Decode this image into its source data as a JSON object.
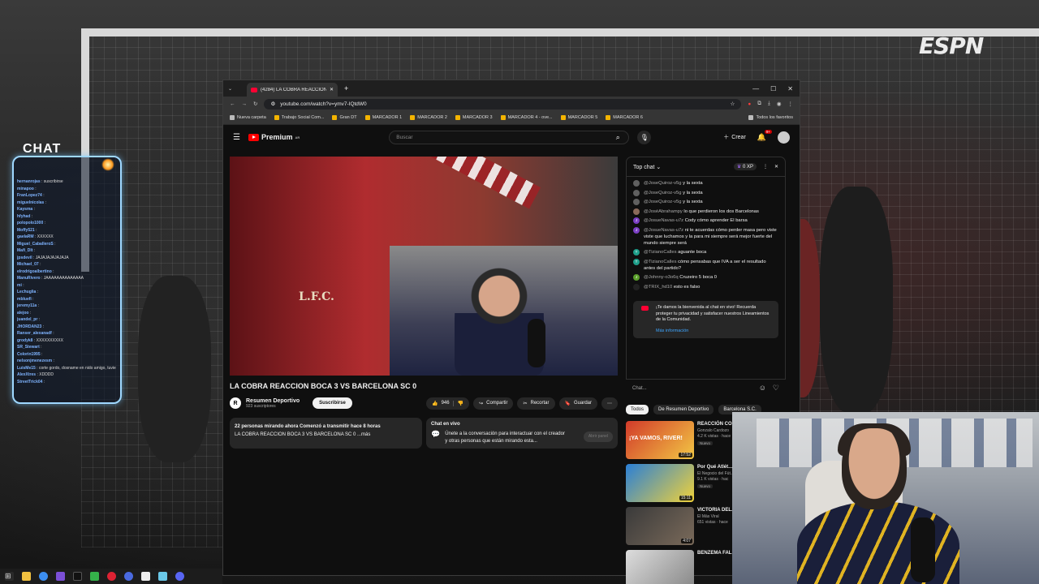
{
  "overlay": {
    "chat_title": "CHAT",
    "brand": "ESPN",
    "messages": [
      {
        "user": "hernanrojas",
        "text": "suscribirse"
      },
      {
        "user": "minapoo",
        "text": ""
      },
      {
        "user": "FranLopez74",
        "text": ""
      },
      {
        "user": "miguelnicolas",
        "text": ""
      },
      {
        "user": "Kaysma",
        "text": ""
      },
      {
        "user": "hfyhad",
        "text": ""
      },
      {
        "user": "polopolo1000",
        "text": ""
      },
      {
        "user": "Moffy521",
        "text": ""
      },
      {
        "user": "gaelaRM",
        "text": "XXXXXX"
      },
      {
        "user": "Miguel_CaballeroS",
        "text": ""
      },
      {
        "user": "Mafi_Dlt",
        "text": ""
      },
      {
        "user": "jpsdevil",
        "text": "JAJAJAJAJAJAJA"
      },
      {
        "user": "Michael_07",
        "text": ""
      },
      {
        "user": "elrodrigoalbertino",
        "text": ""
      },
      {
        "user": "ManuRivero",
        "text": "JAAAAAAAAAAAAAA"
      },
      {
        "user": "mi",
        "text": ""
      },
      {
        "user": "Lechuglia",
        "text": ""
      },
      {
        "user": "mbluefi",
        "text": ""
      },
      {
        "user": "jeremy11a",
        "text": ""
      },
      {
        "user": "alejoo",
        "text": ""
      },
      {
        "user": "juandel_pr",
        "text": ""
      },
      {
        "user": "JHORDAN23",
        "text": ""
      },
      {
        "user": "Ranser_alexanadf",
        "text": ""
      },
      {
        "user": "grodyk8",
        "text": "XXXXXXXXXX"
      },
      {
        "user": "SR_Stewart",
        "text": ""
      },
      {
        "user": "Colorin1995",
        "text": ""
      },
      {
        "user": "nelsonjmenezesm",
        "text": ""
      },
      {
        "user": "LuisMe15",
        "text": "corte gordo, dosname en nido amigo, tuvie en mal dia"
      },
      {
        "user": "AlexXtres",
        "text": "XDDDD"
      },
      {
        "user": "StreetTrick04",
        "text": ""
      }
    ]
  },
  "browser": {
    "tab_title": "(4284) LA COBRA REACCION B",
    "url": "youtube.com/watch?v=ymv7-IQtdW0",
    "bookmarks": [
      {
        "label": "Nueva carpeta",
        "folder": true
      },
      {
        "label": "Trabajo Social Com...",
        "folder": false
      },
      {
        "label": "Gran DT",
        "folder": false
      },
      {
        "label": "MARCADOR 1",
        "folder": false
      },
      {
        "label": "MARCADOR 2",
        "folder": false
      },
      {
        "label": "MARCADOR 3",
        "folder": false
      },
      {
        "label": "MARCADOR 4 - ove...",
        "folder": false
      },
      {
        "label": "MARCADOR 5",
        "folder": false
      },
      {
        "label": "MARCADOR 6",
        "folder": false
      }
    ],
    "all_bookmarks": "Todos los favoritos"
  },
  "youtube": {
    "logo": "Premium",
    "logo_sup": "AR",
    "search_placeholder": "Buscar",
    "create_label": "Crear",
    "notif_badge": "9+",
    "video": {
      "lfc_text": "L.F.C.",
      "title": "LA COBRA REACCION BOCA 3 VS BARCELONA SC 0",
      "channel": "Resumen Deportivo",
      "channel_initials": "R",
      "subscribers": "923 suscriptores",
      "subscribe": "Suscribirse",
      "likes": "946",
      "share": "Compartir",
      "clip": "Recortar",
      "save": "Guardar",
      "desc_line1": "22 personas mirando ahora  Comenzó a transmitir hace 8 horas",
      "desc_line2": "LA COBRA REACCION BOCA 3 VS BARCELONA SC 0 ...más",
      "livechat_title": "Chat en vivo",
      "livechat_text": "Únete a la conversación para interactuar con el creador y otras personas que están mirando esta...",
      "livechat_button": "Abrir panel"
    },
    "chat": {
      "header": "Top chat",
      "xp": "0 XP",
      "messages": [
        {
          "user": "@JoseQuiroz-v5g",
          "text": "y la sexta",
          "avatar": "",
          "color": "#606060"
        },
        {
          "user": "@JoseQuiroz-v5g",
          "text": "y la sexta",
          "avatar": "",
          "color": "#606060"
        },
        {
          "user": "@JoseQuiroz-v5g",
          "text": "y la sexta",
          "avatar": "",
          "color": "#606060"
        },
        {
          "user": "@JoséAbrahampy",
          "text": "lo que perdieron los dos Barcelonas",
          "avatar": "",
          "color": "#8a6a5a"
        },
        {
          "user": "@JosueNavas-u7z",
          "text": "Cody cómo aprender El barsa",
          "avatar": "J",
          "color": "#7b3fc4"
        },
        {
          "user": "@JosueNavas-u7z",
          "text": "ni te acuerdas cómo perder masa pero viste viste que luchamos y la para mi siempre será mejor fuerte del mundo siempre será",
          "avatar": "J",
          "color": "#7b3fc4"
        },
        {
          "user": "@TizianoCalles",
          "text": "aguante boca",
          "avatar": "T",
          "color": "#1e9e8a"
        },
        {
          "user": "@TizianoCalles",
          "text": "cómo pensabas que IVA a ser el resultado antes del partido?",
          "avatar": "T",
          "color": "#1e9e8a"
        },
        {
          "user": "@Johnny-o3o6q",
          "text": "Cruzeiro 5 boca 0",
          "avatar": "J",
          "color": "#5a9e2a"
        },
        {
          "user": "@TRIX_hd10",
          "text": "esto es falso",
          "avatar": "",
          "color": "#222222"
        }
      ],
      "notice": "¡Te damos la bienvenida al chat en vivo! Recuerda proteger tu privacidad y satisfacer nuestros Lineamientos de la Comunidad.",
      "notice_more": "Más información",
      "input_placeholder": "Chat..."
    },
    "chips": [
      "Todos",
      "De Resumen Deportivo",
      "Barcelona S.C."
    ],
    "recs": [
      {
        "title": "REACCIÓN CO... BOCA 3-0 BAR...",
        "meta1": "Gonzalo Cardozo",
        "meta2": "4.2 K vistas · hace",
        "badge": "Nuevo",
        "duration": "17:52",
        "thumb_label": "¡YA VAMOS, RIVER!",
        "c1": "#d23a2a",
        "c2": "#f2c744"
      },
      {
        "title": "Por Qué Atlét... Tiene EXCUSA...",
        "meta1": "El Negocio del Fút...",
        "meta2": "9.1 K vistas · hac",
        "badge": "Nuevo",
        "duration": "15:11",
        "thumb_label": "",
        "c1": "#2a7fd6",
        "c2": "#f0d23a"
      },
      {
        "title": "VICTORIA DEL... EL REAL MADR...",
        "meta1": "El Más Viral",
        "meta2": "651 vistas · hace",
        "badge": "",
        "duration": "4:07",
        "thumb_label": "",
        "c1": "#3a3a3a",
        "c2": "#7a6a5a"
      },
      {
        "title": "BENZEMA FAL... AL-HILAL SE D...",
        "meta1": "",
        "meta2": "",
        "badge": "",
        "duration": "",
        "thumb_label": "",
        "c1": "#ddd",
        "c2": "#888"
      }
    ]
  }
}
